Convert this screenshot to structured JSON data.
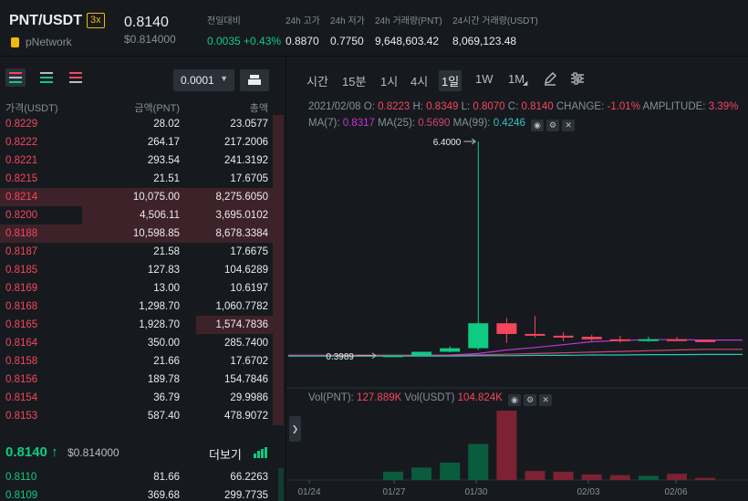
{
  "header": {
    "pair": "PNT/USDT",
    "leverage": "3x",
    "coin_name": "pNetwork",
    "last_price": "0.8140",
    "last_price_usd": "$0.814000",
    "stats": [
      {
        "label": "전일대비",
        "value": "0.0035 +0.43%",
        "color": "green"
      },
      {
        "label": "24h 고가",
        "value": "0.8870"
      },
      {
        "label": "24h 저가",
        "value": "0.7750"
      },
      {
        "label": "24h 거래량(PNT)",
        "value": "9,648,603.42"
      },
      {
        "label": "24시간 거래량(USDT)",
        "value": "8,069,123.48"
      }
    ]
  },
  "orderbook": {
    "tick_size": "0.0001",
    "columns": {
      "price": "가격(USDT)",
      "amount": "금액(PNT)",
      "total": "총액"
    },
    "asks": [
      {
        "price": "0.8229",
        "amount": "28.02",
        "total": "23.0577",
        "depth": 0.04
      },
      {
        "price": "0.8222",
        "amount": "264.17",
        "total": "217.2006",
        "depth": 0.04
      },
      {
        "price": "0.8221",
        "amount": "293.54",
        "total": "241.3192",
        "depth": 0.04
      },
      {
        "price": "0.8215",
        "amount": "21.51",
        "total": "17.6705",
        "depth": 0.04
      },
      {
        "price": "0.8214",
        "amount": "10,075.00",
        "total": "8,275.6050",
        "depth": 1.0
      },
      {
        "price": "0.8200",
        "amount": "4,506.11",
        "total": "3,695.0102",
        "depth": 0.71
      },
      {
        "price": "0.8188",
        "amount": "10,598.85",
        "total": "8,678.3384",
        "depth": 1.0
      },
      {
        "price": "0.8187",
        "amount": "21.58",
        "total": "17.6675",
        "depth": 0.04
      },
      {
        "price": "0.8185",
        "amount": "127.83",
        "total": "104.6289",
        "depth": 0.04
      },
      {
        "price": "0.8169",
        "amount": "13.00",
        "total": "10.6197",
        "depth": 0.04
      },
      {
        "price": "0.8168",
        "amount": "1,298.70",
        "total": "1,060.7782",
        "depth": 0.04
      },
      {
        "price": "0.8165",
        "amount": "1,928.70",
        "total": "1,574.7836",
        "depth": 0.31
      },
      {
        "price": "0.8164",
        "amount": "350.00",
        "total": "285.7400",
        "depth": 0.04
      },
      {
        "price": "0.8158",
        "amount": "21.66",
        "total": "17.6702",
        "depth": 0.04
      },
      {
        "price": "0.8156",
        "amount": "189.78",
        "total": "154.7846",
        "depth": 0.04
      },
      {
        "price": "0.8154",
        "amount": "36.79",
        "total": "29.9986",
        "depth": 0.04
      },
      {
        "price": "0.8153",
        "amount": "587.40",
        "total": "478.9072",
        "depth": 0.04
      }
    ],
    "mid_price": "0.8140",
    "mid_arrow": "↑",
    "mid_usd": "$0.814000",
    "more_label": "더보기",
    "bids": [
      {
        "price": "0.8110",
        "amount": "81.66",
        "total": "66.2263",
        "depth": 0.02
      },
      {
        "price": "0.8109",
        "amount": "369.68",
        "total": "299.7735",
        "depth": 0.02
      }
    ]
  },
  "chart": {
    "timeframes": [
      "시간",
      "15분",
      "1시",
      "4시",
      "1일",
      "1W",
      "1M"
    ],
    "active_timeframe": "1일",
    "ohlc": {
      "date": "2021/02/08",
      "open_label": "O:",
      "open": "0.8223",
      "high_label": "H:",
      "high": "0.8349",
      "low_label": "L:",
      "low": "0.8070",
      "close_label": "C:",
      "close": "0.8140",
      "change_label": "CHANGE:",
      "change": "-1.01%",
      "amplitude_label": "AMPLITUDE:",
      "amplitude": "3.39%"
    },
    "ma": {
      "ma7_label": "MA(7):",
      "ma7": "0.8317",
      "ma25_label": "MA(25):",
      "ma25": "0.5690",
      "ma99_label": "MA(99):",
      "ma99": "0.4246"
    },
    "volume": {
      "pnt_label": "Vol(PNT):",
      "pnt": "127.889K",
      "usdt_label": "Vol(USDT)",
      "usdt": "104.824K"
    },
    "high_marker": "6.4000",
    "low_marker": "0.3989",
    "x_labels": [
      "01/24",
      "01/27",
      "01/30",
      "02/03",
      "02/06"
    ],
    "colors": {
      "up": "#0ecb81",
      "down": "#f6465d",
      "ma7": "#c333d6",
      "ma25": "#d1456b",
      "ma99": "#2ec4c4"
    }
  },
  "chart_data": {
    "type": "candlestick",
    "x": [
      "01/28",
      "01/29",
      "01/30",
      "01/31",
      "02/01",
      "02/02",
      "02/03",
      "02/04",
      "02/05",
      "02/06",
      "02/07",
      "02/08"
    ],
    "open": [
      0.4,
      0.4,
      0.5,
      0.6,
      1.3,
      1.0,
      0.95,
      0.92,
      0.85,
      0.8,
      0.85,
      0.8223
    ],
    "high": [
      0.42,
      0.45,
      0.65,
      6.4,
      1.45,
      1.5,
      1.05,
      0.98,
      0.95,
      0.92,
      0.92,
      0.8349
    ],
    "low": [
      0.39,
      0.3989,
      0.48,
      0.55,
      0.75,
      0.9,
      0.8,
      0.78,
      0.75,
      0.78,
      0.8,
      0.807
    ],
    "close": [
      0.4,
      0.5,
      0.6,
      1.3,
      1.0,
      0.95,
      0.92,
      0.85,
      0.8,
      0.85,
      0.82,
      0.814
    ],
    "volume_rel": [
      0.12,
      0.18,
      0.25,
      0.52,
      1.0,
      0.13,
      0.12,
      0.08,
      0.07,
      0.06,
      0.09,
      0.03
    ],
    "ylim": [
      0.0,
      6.4
    ]
  }
}
